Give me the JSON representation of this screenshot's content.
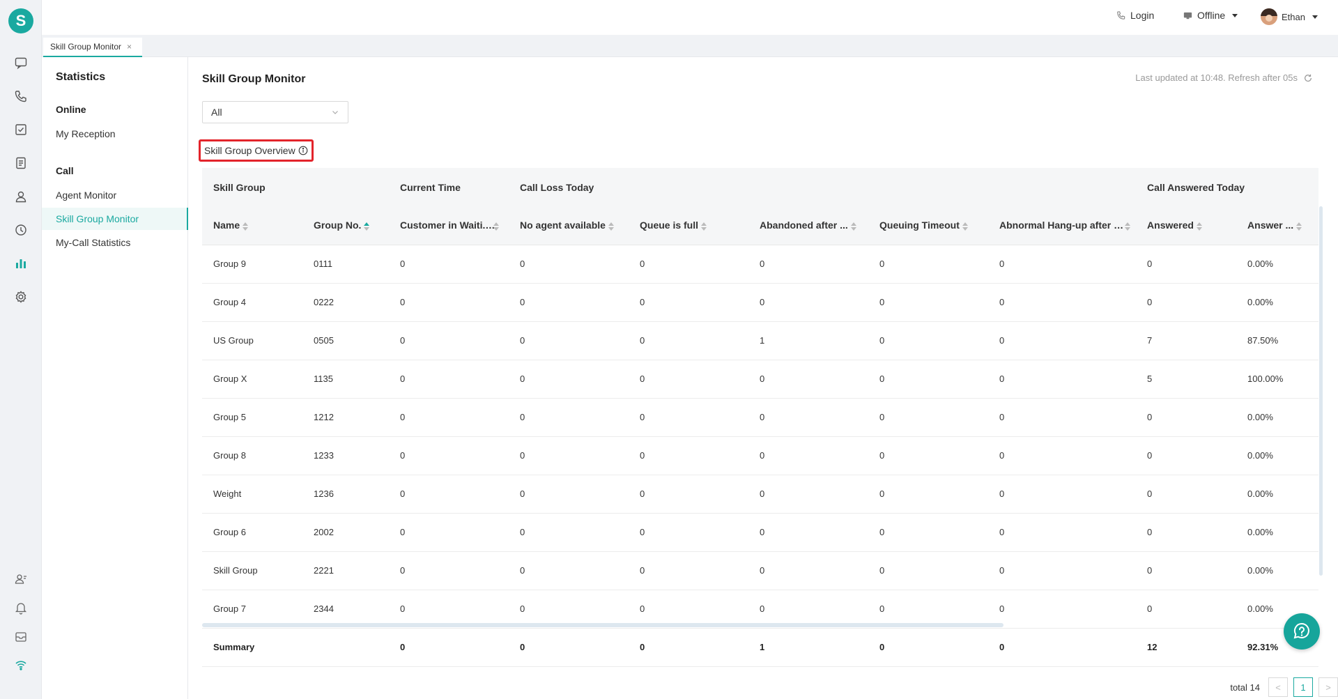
{
  "brand": {
    "logo_letter": "S",
    "accent": "#1aa9a0"
  },
  "rail": {
    "icons": [
      "chat-icon",
      "phone-icon",
      "task-icon",
      "document-icon",
      "contact-icon",
      "history-icon",
      "statistics-icon",
      "settings-icon",
      "agent-status-icon",
      "bell-icon",
      "inbox-icon",
      "wifi-icon"
    ]
  },
  "topbar": {
    "login": "Login",
    "status": "Offline",
    "user": "Ethan"
  },
  "tabs": [
    {
      "label": "Skill Group Monitor",
      "close": "×"
    }
  ],
  "sidebar": {
    "title": "Statistics",
    "groups": [
      {
        "label": "Online",
        "items": [
          {
            "label": "My Reception"
          }
        ]
      },
      {
        "label": "Call",
        "items": [
          {
            "label": "Agent Monitor"
          },
          {
            "label": "Skill Group Monitor",
            "active": true
          },
          {
            "label": "My-Call Statistics"
          }
        ]
      }
    ]
  },
  "main": {
    "title": "Skill Group Monitor",
    "refresh_text": "Last updated at 10:48. Refresh after 05s",
    "filter_value": "All",
    "section_title": "Skill Group Overview",
    "group_headers": [
      "Skill Group",
      "Current Time",
      "Call Loss Today",
      "Call Answered Today"
    ],
    "columns": [
      "Name",
      "Group No.",
      "Customer in Waiti...",
      "No agent available",
      "Queue is full",
      "Abandoned after ...",
      "Queuing Timeout",
      "Abnormal Hang-up after ...",
      "Answered",
      "Answer ..."
    ],
    "rows": [
      [
        "Group 9",
        "0111",
        "0",
        "0",
        "0",
        "0",
        "0",
        "0",
        "0",
        "0.00%"
      ],
      [
        "Group 4",
        "0222",
        "0",
        "0",
        "0",
        "0",
        "0",
        "0",
        "0",
        "0.00%"
      ],
      [
        "US Group",
        "0505",
        "0",
        "0",
        "0",
        "1",
        "0",
        "0",
        "7",
        "87.50%"
      ],
      [
        "Group X",
        "1135",
        "0",
        "0",
        "0",
        "0",
        "0",
        "0",
        "5",
        "100.00%"
      ],
      [
        "Group 5",
        "1212",
        "0",
        "0",
        "0",
        "0",
        "0",
        "0",
        "0",
        "0.00%"
      ],
      [
        "Group 8",
        "1233",
        "0",
        "0",
        "0",
        "0",
        "0",
        "0",
        "0",
        "0.00%"
      ],
      [
        "Weight",
        "1236",
        "0",
        "0",
        "0",
        "0",
        "0",
        "0",
        "0",
        "0.00%"
      ],
      [
        "Group 6",
        "2002",
        "0",
        "0",
        "0",
        "0",
        "0",
        "0",
        "0",
        "0.00%"
      ],
      [
        "Skill Group",
        "2221",
        "0",
        "0",
        "0",
        "0",
        "0",
        "0",
        "0",
        "0.00%"
      ],
      [
        "Group 7",
        "2344",
        "0",
        "0",
        "0",
        "0",
        "0",
        "0",
        "0",
        "0.00%"
      ]
    ],
    "summary": [
      "Summary",
      "",
      "0",
      "0",
      "0",
      "1",
      "0",
      "0",
      "12",
      "92.31%"
    ]
  },
  "pagination": {
    "total": "total 14",
    "current": "1",
    "prev": "<",
    "next": ">"
  }
}
